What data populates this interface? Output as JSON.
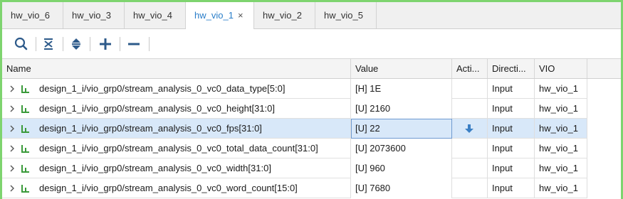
{
  "tabs": [
    {
      "label": "hw_vio_6",
      "active": false
    },
    {
      "label": "hw_vio_3",
      "active": false
    },
    {
      "label": "hw_vio_4",
      "active": false
    },
    {
      "label": "hw_vio_1",
      "active": true,
      "close": "×"
    },
    {
      "label": "hw_vio_2",
      "active": false
    },
    {
      "label": "hw_vio_5",
      "active": false
    }
  ],
  "toolbar": {
    "icons": [
      "search-icon",
      "collapse-all-icon",
      "expand-all-icon",
      "add-icon",
      "remove-icon"
    ]
  },
  "columns": {
    "name": "Name",
    "value": "Value",
    "activity": "Acti...",
    "direction": "Directi...",
    "vio": "VIO"
  },
  "rows": [
    {
      "name": "design_1_i/vio_grp0/stream_analysis_0_vc0_data_type[5:0]",
      "value": "[H] 1E",
      "activity": "",
      "direction": "Input",
      "vio": "hw_vio_1"
    },
    {
      "name": "design_1_i/vio_grp0/stream_analysis_0_vc0_height[31:0]",
      "value": "[U] 2160",
      "activity": "",
      "direction": "Input",
      "vio": "hw_vio_1"
    },
    {
      "name": "design_1_i/vio_grp0/stream_analysis_0_vc0_fps[31:0]",
      "value": "[U] 22",
      "activity": "down-arrow",
      "direction": "Input",
      "vio": "hw_vio_1"
    },
    {
      "name": "design_1_i/vio_grp0/stream_analysis_0_vc0_total_data_count[31:0]",
      "value": "[U] 2073600",
      "activity": "",
      "direction": "Input",
      "vio": "hw_vio_1"
    },
    {
      "name": "design_1_i/vio_grp0/stream_analysis_0_vc0_width[31:0]",
      "value": "[U] 960",
      "activity": "",
      "direction": "Input",
      "vio": "hw_vio_1"
    },
    {
      "name": "design_1_i/vio_grp0/stream_analysis_0_vc0_word_count[15:0]",
      "value": "[U] 7680",
      "activity": "",
      "direction": "Input",
      "vio": "hw_vio_1"
    }
  ],
  "colors": {
    "accent": "#2a7ec9",
    "selection": "#d8e8f9",
    "frame": "#7ed46f",
    "signal_icon": "#3a9a3a",
    "activity_arrow": "#3b7fc4"
  }
}
